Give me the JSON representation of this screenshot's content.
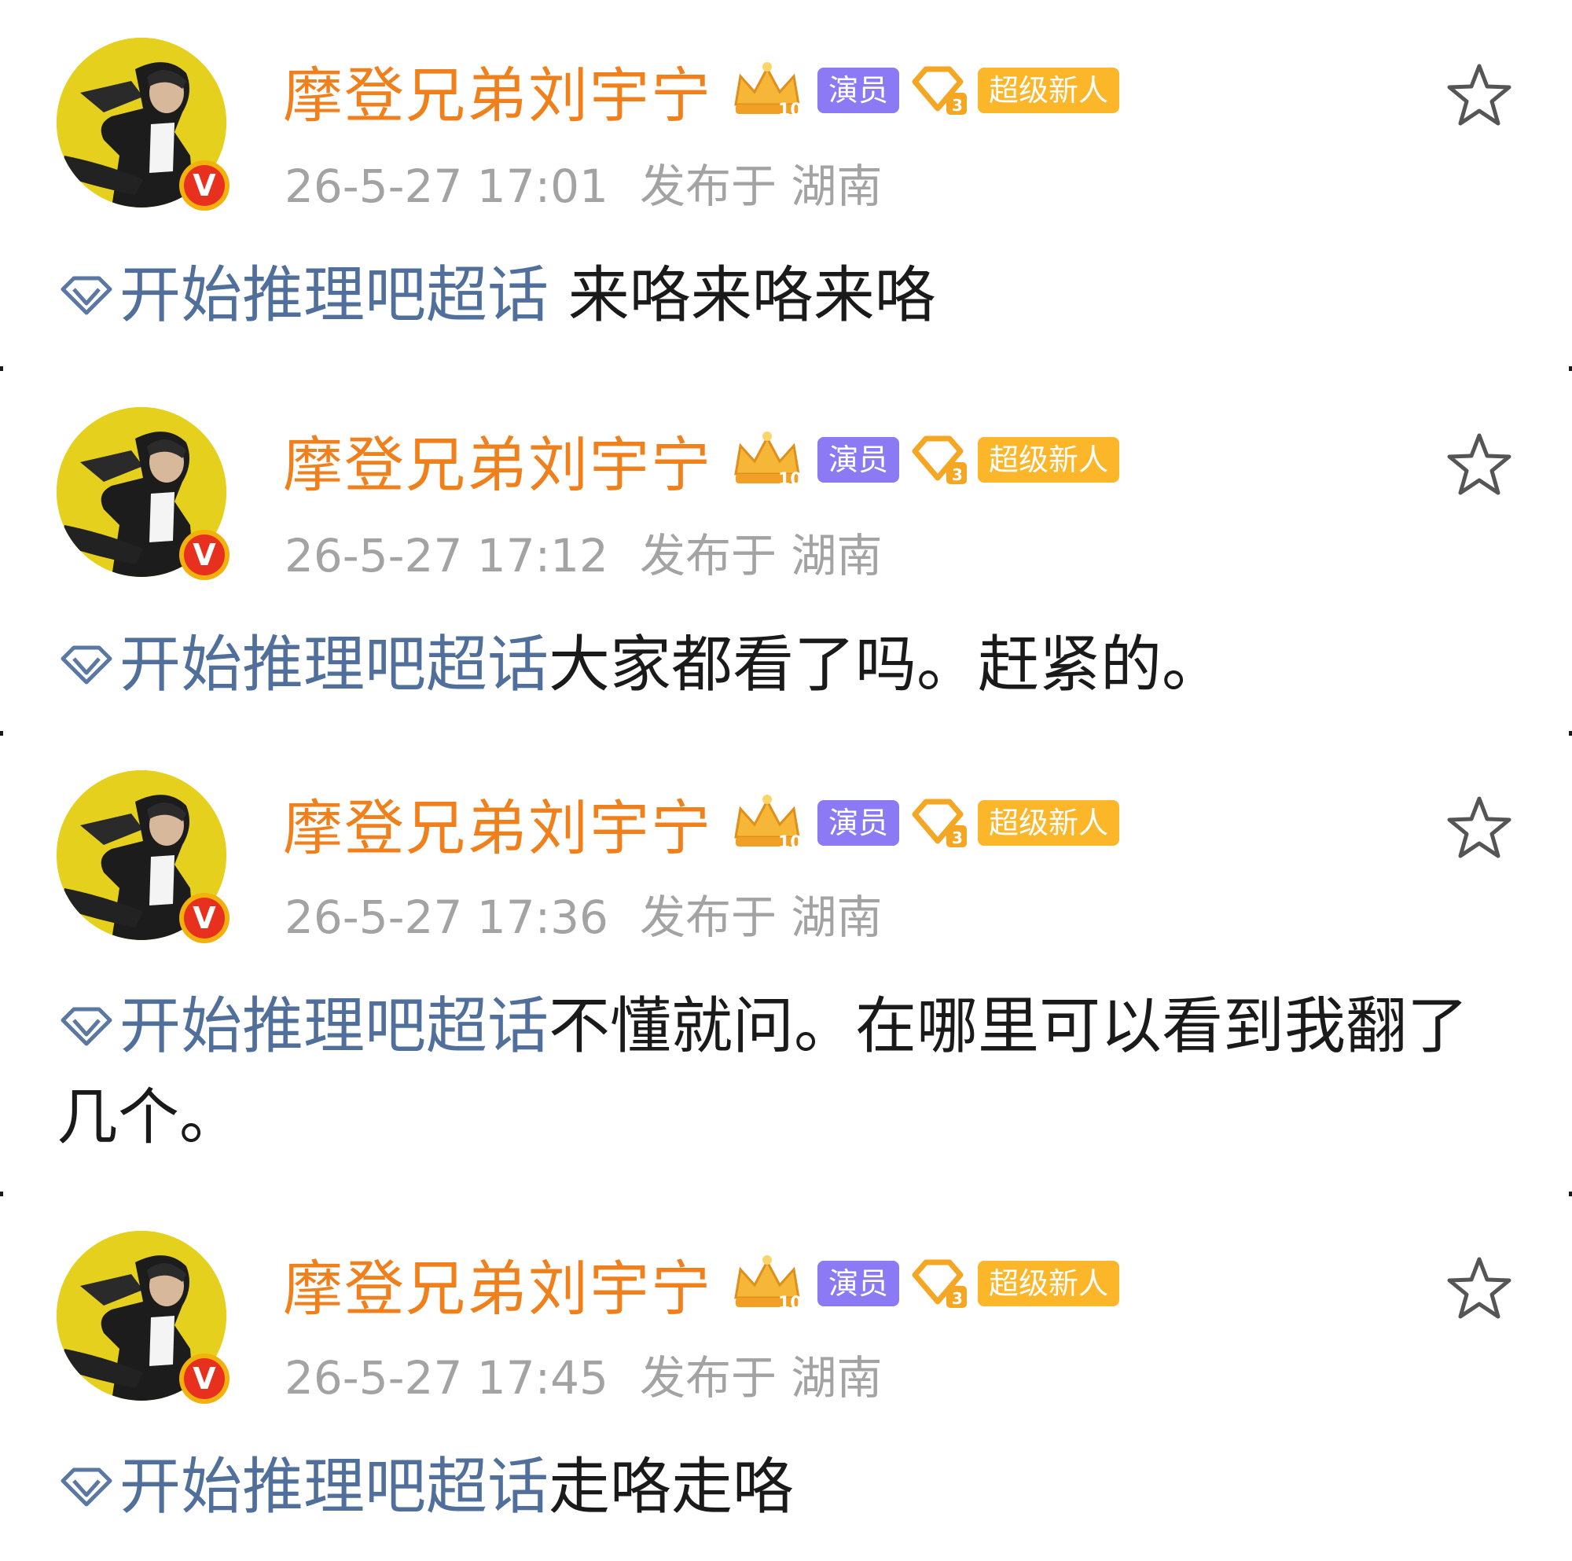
{
  "posts": [
    {
      "username": "摩登兄弟刘宇宁",
      "role_badge": "演员",
      "level_tag": "超级新人",
      "crown_level": "10",
      "diamond_level": "3",
      "timestamp": "26-5-27 17:01",
      "location": "发布于 湖南",
      "topic": "开始推理吧超话",
      "text": " 来咯来咯来咯"
    },
    {
      "username": "摩登兄弟刘宇宁",
      "role_badge": "演员",
      "level_tag": "超级新人",
      "crown_level": "10",
      "diamond_level": "3",
      "timestamp": "26-5-27 17:12",
      "location": "发布于 湖南",
      "topic": "开始推理吧超话",
      "text": "大家都看了吗。赶紧的。"
    },
    {
      "username": "摩登兄弟刘宇宁",
      "role_badge": "演员",
      "level_tag": "超级新人",
      "crown_level": "10",
      "diamond_level": "3",
      "timestamp": "26-5-27 17:36",
      "location": "发布于 湖南",
      "topic": "开始推理吧超话",
      "text": "不懂就问。在哪里可以看到我翻了几个。"
    },
    {
      "username": "摩登兄弟刘宇宁",
      "role_badge": "演员",
      "level_tag": "超级新人",
      "crown_level": "10",
      "diamond_level": "3",
      "timestamp": "26-5-27 17:45",
      "location": "发布于 湖南",
      "topic": "开始推理吧超话",
      "text": "走咯走咯"
    }
  ],
  "colors": {
    "username": "#f0801c",
    "topic_link": "#506f9b",
    "meta_text": "#a3a3a3",
    "role_badge_bg": "#8b7af4",
    "level_tag_bg": "#fbb62a",
    "verified_badge": "#e8301e"
  },
  "icons": {
    "crown": "crown-level-icon",
    "diamond": "diamond-fan-icon",
    "star": "star-outline-icon",
    "topic": "super-topic-diamond-icon",
    "verified": "verified-v-icon"
  }
}
